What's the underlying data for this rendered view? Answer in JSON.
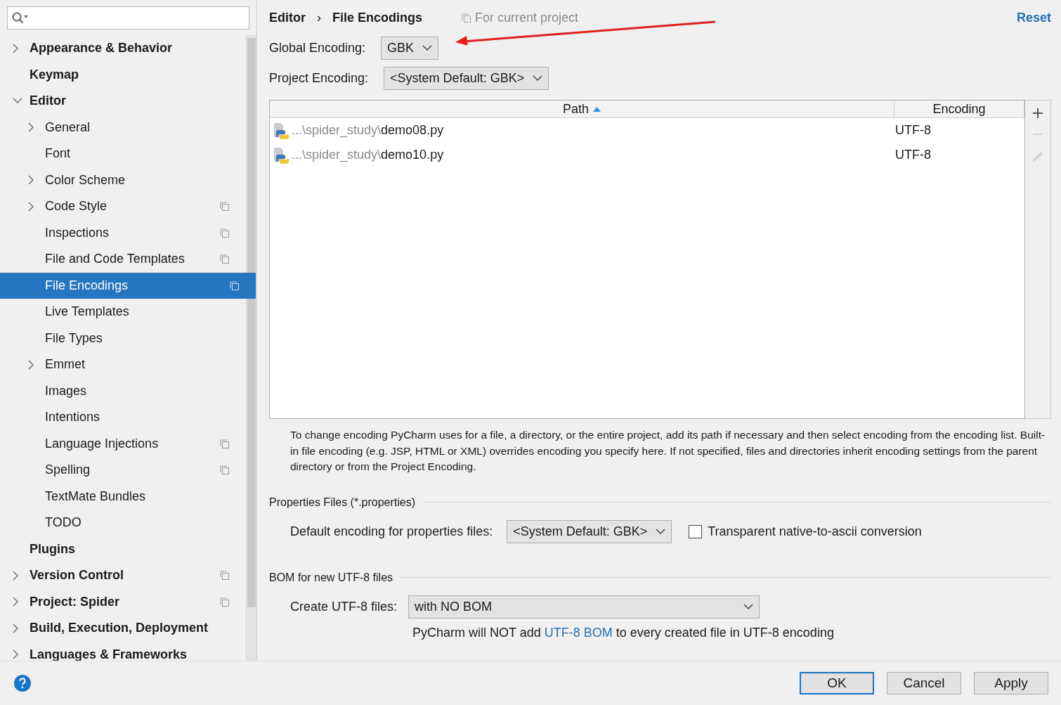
{
  "sidebar": {
    "items": [
      {
        "label": "Appearance & Behavior",
        "expanded": false,
        "selected": false,
        "project_icon": false
      },
      {
        "label": "Keymap",
        "selected": false,
        "project_icon": false
      },
      {
        "label": "Editor",
        "expanded": true,
        "selected": false,
        "project_icon": false,
        "children": [
          {
            "label": "General",
            "expanded": false,
            "selected": false,
            "project_icon": false
          },
          {
            "label": "Font",
            "selected": false,
            "project_icon": false
          },
          {
            "label": "Color Scheme",
            "expanded": false,
            "selected": false,
            "project_icon": false
          },
          {
            "label": "Code Style",
            "expanded": false,
            "selected": false,
            "project_icon": true
          },
          {
            "label": "Inspections",
            "selected": false,
            "project_icon": true
          },
          {
            "label": "File and Code Templates",
            "selected": false,
            "project_icon": true
          },
          {
            "label": "File Encodings",
            "selected": true,
            "project_icon": true
          },
          {
            "label": "Live Templates",
            "selected": false,
            "project_icon": false
          },
          {
            "label": "File Types",
            "selected": false,
            "project_icon": false
          },
          {
            "label": "Emmet",
            "expanded": false,
            "selected": false,
            "project_icon": false
          },
          {
            "label": "Images",
            "selected": false,
            "project_icon": false
          },
          {
            "label": "Intentions",
            "selected": false,
            "project_icon": false
          },
          {
            "label": "Language Injections",
            "selected": false,
            "project_icon": true
          },
          {
            "label": "Spelling",
            "selected": false,
            "project_icon": true
          },
          {
            "label": "TextMate Bundles",
            "selected": false,
            "project_icon": false
          },
          {
            "label": "TODO",
            "selected": false,
            "project_icon": false
          }
        ]
      },
      {
        "label": "Plugins",
        "selected": false,
        "project_icon": false
      },
      {
        "label": "Version Control",
        "expanded": false,
        "selected": false,
        "project_icon": true
      },
      {
        "label": "Project: Spider",
        "expanded": false,
        "selected": false,
        "project_icon": true
      },
      {
        "label": "Build, Execution, Deployment",
        "expanded": false,
        "selected": false,
        "project_icon": false
      },
      {
        "label": "Languages & Frameworks",
        "expanded": false,
        "selected": false,
        "project_icon": false
      }
    ]
  },
  "breadcrumb": {
    "parent": "Editor",
    "separator": "›",
    "current": "File Encodings",
    "scope": "For current project",
    "reset": "Reset"
  },
  "global_encoding": {
    "label": "Global Encoding:",
    "value": "GBK"
  },
  "project_encoding": {
    "label": "Project Encoding:",
    "value": "<System Default: GBK>"
  },
  "table": {
    "columns": [
      {
        "label": "Path",
        "sorted": true
      },
      {
        "label": "Encoding",
        "sorted": false
      }
    ],
    "rows": [
      {
        "path_prefix": "...\\spider_study\\",
        "file": "demo08.py",
        "encoding": "UTF-8"
      },
      {
        "path_prefix": "...\\spider_study\\",
        "file": "demo10.py",
        "encoding": "UTF-8"
      }
    ]
  },
  "description": "To change encoding PyCharm uses for a file, a directory, or the entire project, add its path if necessary and then select encoding from the encoding list. Built-in file encoding (e.g. JSP, HTML or XML) overrides encoding you specify here. If not specified, files and directories inherit encoding settings from the parent directory or from the Project Encoding.",
  "properties": {
    "title": "Properties Files (*.properties)",
    "label": "Default encoding for properties files:",
    "value": "<System Default: GBK>",
    "checkbox": {
      "label": "Transparent native-to-ascii conversion",
      "checked": false
    }
  },
  "bom": {
    "title": "BOM for new UTF-8 files",
    "label": "Create UTF-8 files:",
    "value": "with NO BOM",
    "note_before": "PyCharm will NOT add",
    "note_link": "UTF-8 BOM",
    "note_after": "to every created file in UTF-8 encoding"
  },
  "buttons": [
    {
      "label": "OK",
      "default": true
    },
    {
      "label": "Cancel",
      "default": false
    },
    {
      "label": "Apply",
      "default": false
    }
  ]
}
